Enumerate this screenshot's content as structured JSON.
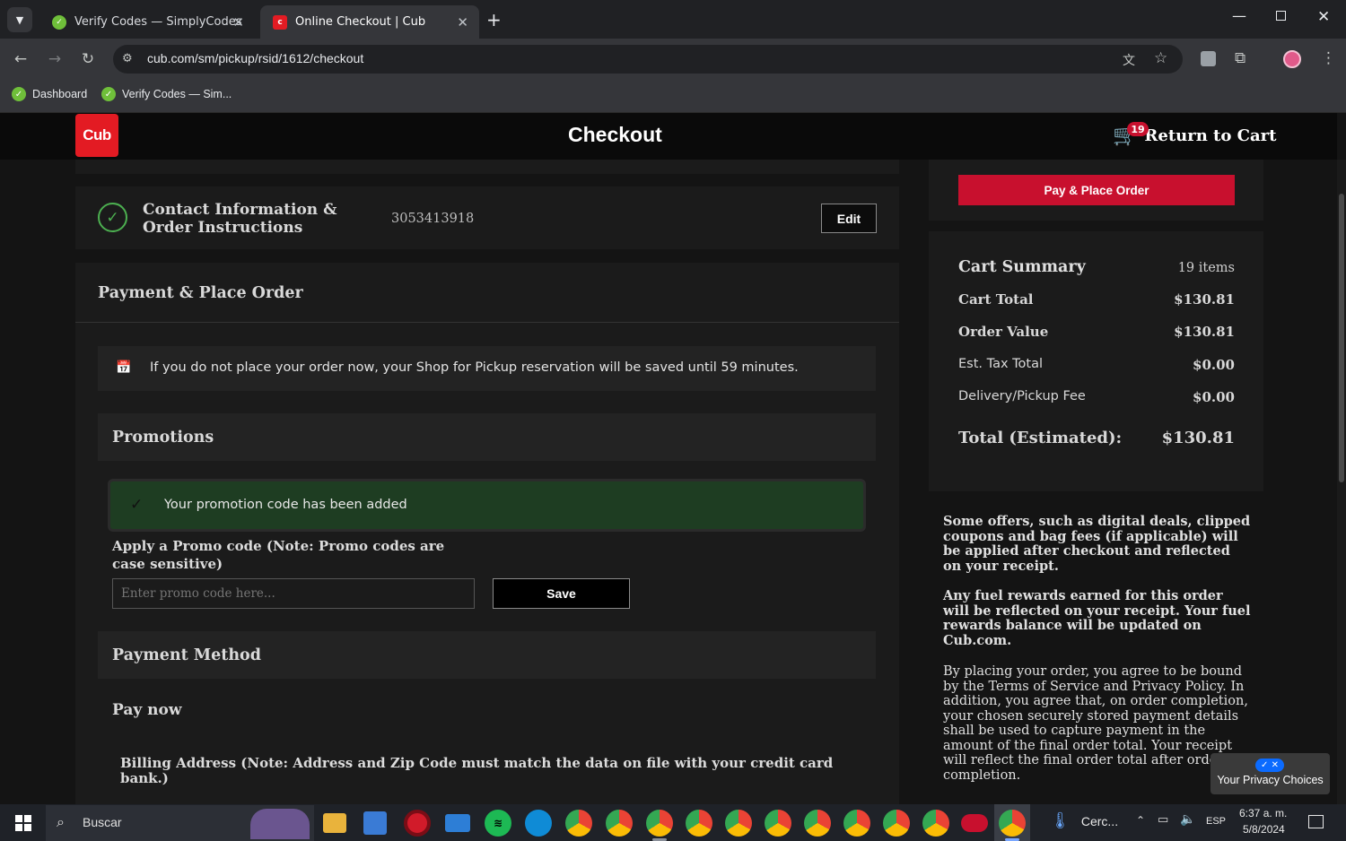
{
  "browser": {
    "tabs": [
      {
        "title": "Verify Codes — SimplyCodes",
        "active": false
      },
      {
        "title": "Online Checkout | Cub",
        "active": true
      }
    ],
    "url": "cub.com/sm/pickup/rsid/1612/checkout",
    "bookmarks": [
      "Dashboard",
      "Verify Codes — Sim..."
    ]
  },
  "header": {
    "logo_text": "Cub",
    "title": "Checkout",
    "cart_label": "Return to Cart",
    "cart_count": "19"
  },
  "contact": {
    "title": "Contact Information & Order Instructions",
    "phone": "3053413918",
    "edit_label": "Edit"
  },
  "payment_section": {
    "title": "Payment & Place Order",
    "reservation_notice": "If you do not place your order now, your Shop for Pickup reservation will be saved until 59 minutes.",
    "promotions_title": "Promotions",
    "promo_success": "Your promotion code has been added",
    "promo_label": "Apply a Promo code (Note: Promo codes are case sensitive)",
    "promo_placeholder": "Enter promo code here...",
    "save_label": "Save",
    "payment_method_title": "Payment Method",
    "pay_now": "Pay now",
    "billing_note": "Billing Address (Note: Address and Zip Code must match the data on file with your credit card bank.)"
  },
  "summary": {
    "place_order_label": "Pay & Place Order",
    "title": "Cart Summary",
    "items": "19 items",
    "rows": [
      {
        "label": "Cart Total",
        "value": "$130.81",
        "bold": true
      },
      {
        "label": "Order Value",
        "value": "$130.81",
        "bold": true
      },
      {
        "label": "Est. Tax Total",
        "value": "$0.00",
        "bold": false
      },
      {
        "label": "Delivery/Pickup Fee",
        "value": "$0.00",
        "bold": false
      }
    ],
    "total_label": "Total (Estimated):",
    "total_value": "$130.81",
    "notes": [
      "Some offers, such as digital deals, clipped coupons and bag fees (if applicable) will be applied after checkout and reflected on your receipt.",
      "Any fuel rewards earned for this order will be reflected on your receipt. Your fuel rewards balance will be updated on Cub.com.",
      "By placing your order, you agree to be bound by the Terms of Service and Privacy Policy. In addition, you agree that, on order completion, your chosen securely stored payment details shall be used to capture payment in the amount of the final order total. Your receipt will reflect the final order total after order completion."
    ],
    "privacy_choices": "Your Privacy Choices"
  },
  "taskbar": {
    "search_placeholder": "Buscar",
    "weather_label": "Cerc...",
    "lang": "ESP",
    "time": "6:37 a. m.",
    "date": "5/8/2024"
  },
  "colors": {
    "brand_red": "#e31b23",
    "button_red": "#c8102e",
    "success_green": "#1e3d22",
    "check_green": "#4caf50"
  }
}
